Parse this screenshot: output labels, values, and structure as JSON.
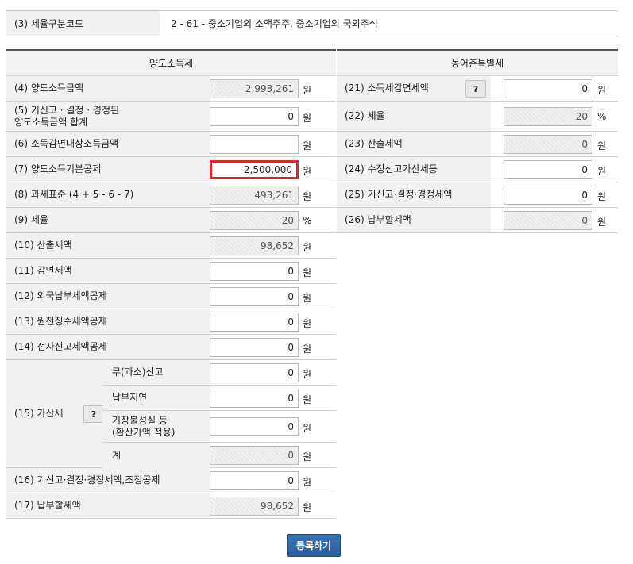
{
  "top": {
    "label": "(3) 세율구분코드",
    "value": "2  -  61  -  중소기업외 소액주주, 중소기업외 국외주식"
  },
  "left": {
    "header": "양도소득세",
    "rows": [
      {
        "label": "(4) 양도소득금액",
        "value": "2,993,261",
        "unit": "원"
      },
      {
        "label": "(5) 기신고 · 결정 · 경정된\n양도소득금액 합계",
        "value": "0",
        "unit": "원"
      },
      {
        "label": "(6) 소득감면대상소득금액",
        "value": "",
        "unit": "원"
      },
      {
        "label": "(7) 양도소득기본공제",
        "value": "2,500,000",
        "unit": "원"
      },
      {
        "label": "(8) 과세표준 (4 + 5 - 6 - 7)",
        "value": "493,261",
        "unit": "원"
      },
      {
        "label": "(9) 세율",
        "value": "20",
        "unit": "%"
      },
      {
        "label": "(10) 산출세액",
        "value": "98,652",
        "unit": "원"
      },
      {
        "label": "(11) 감면세액",
        "value": "0",
        "unit": "원"
      },
      {
        "label": "(12) 외국납부세액공제",
        "value": "0",
        "unit": "원"
      },
      {
        "label": "(13) 원천징수세액공제",
        "value": "0",
        "unit": "원"
      },
      {
        "label": "(14) 전자신고세액공제",
        "value": "0",
        "unit": "원"
      }
    ],
    "gasan": {
      "label": "(15) 가산세",
      "help": "?",
      "subs": [
        {
          "label": "무(과소)신고",
          "value": "0",
          "unit": "원"
        },
        {
          "label": "납부지연",
          "value": "0",
          "unit": "원"
        },
        {
          "label": "기장불성실 등\n(환산가액 적용)",
          "value": "0",
          "unit": "원"
        },
        {
          "label": "계",
          "value": "0",
          "unit": "원"
        }
      ]
    },
    "bottom": [
      {
        "label": "(16) 기신고·결정·경정세액,조정공제",
        "value": "0",
        "unit": "원"
      },
      {
        "label": "(17) 납부할세액",
        "value": "98,652",
        "unit": "원"
      }
    ]
  },
  "right": {
    "header": "농어촌특별세",
    "help": "?",
    "rows": [
      {
        "label": "(21) 소득세감면세액",
        "value": "0",
        "unit": "원"
      },
      {
        "label": "(22) 세율",
        "value": "20",
        "unit": "%"
      },
      {
        "label": "(23) 산출세액",
        "value": "0",
        "unit": "원"
      },
      {
        "label": "(24) 수정신고가산세등",
        "value": "0",
        "unit": "원"
      },
      {
        "label": "(25) 기신고·결정·경정세액",
        "value": "0",
        "unit": "원"
      },
      {
        "label": "(26) 납부할세액",
        "value": "0",
        "unit": "원"
      }
    ]
  },
  "submit_label": "등록하기"
}
